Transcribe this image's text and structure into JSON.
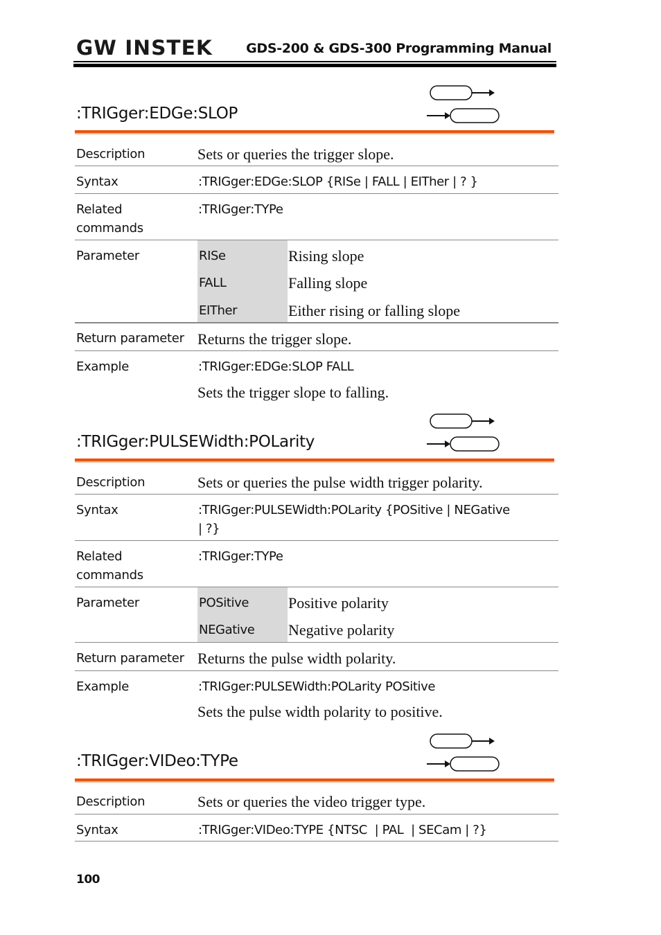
{
  "header": {
    "logo": "GW INSTEK",
    "manual_title": "GDS-200 & GDS-300 Programming Manual"
  },
  "sections": [
    {
      "title": ":TRIGger:EDGe:SLOP",
      "icons": [
        "set-command-icon",
        "query-command-icon"
      ],
      "description_label": "Description",
      "description": "Sets or queries the trigger slope.",
      "syntax_label": "Syntax",
      "syntax": ":TRIGger:EDGe:SLOP {RISe | FALL | EITher | ? }",
      "related_label_1": "Related",
      "related_label_2": "commands",
      "related": ":TRIGger:TYPe",
      "parameter_label": "Parameter",
      "parameters": [
        {
          "key": "RISe",
          "desc": "Rising slope"
        },
        {
          "key": "FALL",
          "desc": "Falling slope"
        },
        {
          "key": "EITher",
          "desc": "Either rising or falling slope"
        }
      ],
      "return_label": "Return parameter",
      "return": "Returns the trigger slope.",
      "example_label": "Example",
      "example_cmd": ":TRIGger:EDGe:SLOP FALL",
      "example_desc": "Sets the trigger slope to falling."
    },
    {
      "title": ":TRIGger:PULSEWidth:POLarity",
      "icons": [
        "set-command-icon",
        "query-command-icon"
      ],
      "description_label": "Description",
      "description": "Sets or queries the pulse width trigger polarity.",
      "syntax_label": "Syntax",
      "syntax_line1": ":TRIGger:PULSEWidth:POLarity {POSitive | NEGative",
      "syntax_line2": "| ?}",
      "related_label_1": "Related",
      "related_label_2": "commands",
      "related": ":TRIGger:TYPe",
      "parameter_label": "Parameter",
      "parameters": [
        {
          "key": "POSitive",
          "desc": "Positive polarity"
        },
        {
          "key": "NEGative",
          "desc": "Negative polarity"
        }
      ],
      "return_label": "Return parameter",
      "return": "Returns the pulse width polarity.",
      "example_label": "Example",
      "example_cmd": ":TRIGger:PULSEWidth:POLarity POSitive",
      "example_desc": "Sets the pulse width polarity to positive."
    },
    {
      "title": ":TRIGger:VIDeo:TYPe",
      "icons": [
        "set-command-icon",
        "query-command-icon"
      ],
      "description_label": "Description",
      "description": "Sets or queries the video trigger type.",
      "syntax_label": "Syntax",
      "syntax": ":TRIGger:VIDeo:TYPE {NTSC  | PAL  | SECam | ?}"
    }
  ],
  "footer": {
    "page_number": "100"
  },
  "colors": {
    "accent_rule": "#e85412",
    "param_shade": "#d9d9d9"
  }
}
